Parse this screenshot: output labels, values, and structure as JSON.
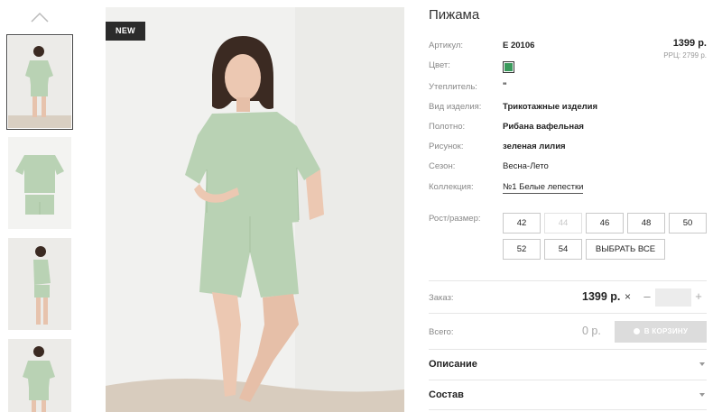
{
  "product": {
    "title": "Пижама",
    "badge": "NEW",
    "price": "1399 р.",
    "rrp": "РРЦ: 2799 р.",
    "color_swatch": "#3a9a5c"
  },
  "specs": [
    {
      "label": "Артикул:",
      "value": "Е 20106"
    },
    {
      "label": "Цвет:",
      "value": ""
    },
    {
      "label": "Утеплитель:",
      "value": "\""
    },
    {
      "label": "Вид изделия:",
      "value": "Трикотажные изделия"
    },
    {
      "label": "Полотно:",
      "value": "Рибана вафельная"
    },
    {
      "label": "Рисунок:",
      "value": "зеленая лилия"
    },
    {
      "label": "Сезон:",
      "value": "Весна-Лето"
    },
    {
      "label": "Коллекция:",
      "value": "№1 Белые лепестки"
    }
  ],
  "sizes": {
    "label": "Рост/размер:",
    "options": [
      "42",
      "44",
      "46",
      "48",
      "50",
      "52",
      "54"
    ],
    "disabled": [
      "44"
    ],
    "select_all": "ВЫБРАТЬ ВСЕ"
  },
  "order": {
    "label": "Заказ:",
    "price": "1399 р.",
    "times": "×",
    "minus": "–",
    "plus": "+",
    "quantity": ""
  },
  "total": {
    "label": "Всего:",
    "value": "0 р.",
    "cart_button": "В КОРЗИНУ"
  },
  "accordion": [
    {
      "title": "Описание"
    },
    {
      "title": "Состав"
    }
  ],
  "colors": {
    "garment": "#b9d2b4",
    "badge_bg": "#2b2b2b",
    "cart_disabled": "#dcdcdc"
  }
}
